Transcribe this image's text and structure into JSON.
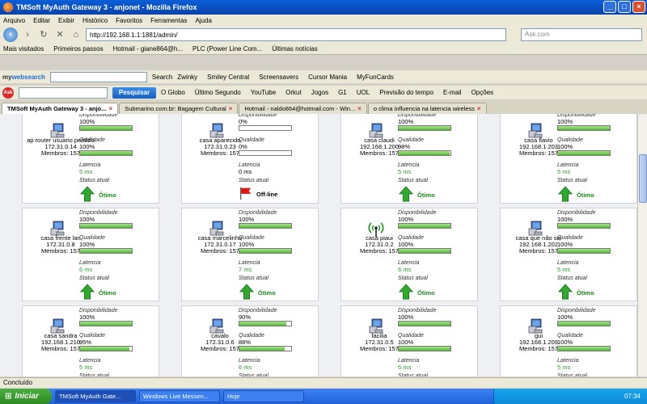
{
  "window": {
    "title": "TMSoft MyAuth Gateway 3 - anjonet - Mozilla Firefox"
  },
  "menu": [
    "Arquivo",
    "Editar",
    "Exibir",
    "Histórico",
    "Favoritos",
    "Ferramentas",
    "Ajuda"
  ],
  "nav": {
    "url": "http://192.168.1.1:1881/admin/",
    "search_placeholder": "Ask.com"
  },
  "bookmarks": [
    "Mais visitados",
    "Primeiros passos",
    "Hotmail - giane864@h...",
    "PLC (Power Line Com...",
    "Últimas notícias"
  ],
  "toolbar1": {
    "logo_a": "my",
    "logo_b": "websearch",
    "search_label": "Search",
    "items": [
      "Zwinky",
      "Smiley Central",
      "Screensavers",
      "Cursor Mania",
      "MyFunCards"
    ]
  },
  "toolbar2": {
    "search_button": "Pesquisar",
    "items": [
      "O Globo",
      "Último Segundo",
      "YouTube",
      "Orkut",
      "Jogos",
      "G1",
      "UOL",
      "Previsão do tempo",
      "E-mail",
      "Opções"
    ]
  },
  "tabs": [
    {
      "label": "TMSoft MyAuth Gateway 3 - anjo...",
      "active": true
    },
    {
      "label": "Submarino.com.br: Bagagem Cultural",
      "active": false
    },
    {
      "label": "Hotmail - naldo864@hotmail.com - Win...",
      "active": false
    },
    {
      "label": "o clima influencia na latencia wireless",
      "active": false
    }
  ],
  "labels": {
    "disp": "Disponibilidade",
    "qual": "Qualidade",
    "lat": "Latencia",
    "stat": "Status atual",
    "membros": "Membros:"
  },
  "devices": [
    {
      "name": "ap router usuario perdido",
      "ip": "172.31.0.14",
      "membros": "157",
      "disp": 100,
      "qual": 100,
      "lat": "5 ms",
      "status": "Ótimo",
      "icon": "pc"
    },
    {
      "name": "casa aparecido",
      "ip": "172.31.0.23",
      "membros": "157",
      "disp": 0,
      "qual": 0,
      "lat": "0 ms",
      "status": "Off-line",
      "icon": "pc"
    },
    {
      "name": "casa claudi",
      "ip": "192.168.1.200",
      "membros": "157",
      "disp": 100,
      "qual": 98,
      "lat": "5 ms",
      "status": "Ótimo",
      "icon": "pc"
    },
    {
      "name": "casa flavio",
      "ip": "192.168.1.203",
      "membros": "157",
      "disp": 100,
      "qual": 100,
      "lat": "5 ms",
      "status": "Ótimo",
      "icon": "pc"
    },
    {
      "name": "casa frente lan",
      "ip": "172.31.0.8",
      "membros": "157",
      "disp": 100,
      "qual": 100,
      "lat": "6 ms",
      "status": "Ótimo",
      "icon": "pc"
    },
    {
      "name": "casa marcelinho",
      "ip": "172.31.0.17",
      "membros": "157",
      "disp": 100,
      "qual": 100,
      "lat": "7 ms",
      "status": "Ótimo",
      "icon": "pc"
    },
    {
      "name": "casa piaui",
      "ip": "172.31.0.2",
      "membros": "157",
      "disp": 100,
      "qual": 100,
      "lat": "6 ms",
      "status": "Ótimo",
      "icon": "antenna"
    },
    {
      "name": "casa que não sei",
      "ip": "192.168.1.202",
      "membros": "157",
      "disp": 100,
      "qual": 100,
      "lat": "5 ms",
      "status": "Ótimo",
      "icon": "pc"
    },
    {
      "name": "casa sandra",
      "ip": "192.168.1.210",
      "membros": "157",
      "disp": 100,
      "qual": 95,
      "lat": "5 ms",
      "status": "",
      "icon": "pc"
    },
    {
      "name": "cavalo",
      "ip": "172.31.0.6",
      "membros": "157",
      "disp": 90,
      "qual": 88,
      "lat": "6 ms",
      "status": "",
      "icon": "pc"
    },
    {
      "name": "facilia",
      "ip": "172.31.0.5",
      "membros": "157",
      "disp": 100,
      "qual": 100,
      "lat": "5 ms",
      "status": "",
      "icon": "pc"
    },
    {
      "name": "gui",
      "ip": "192.168.1.209",
      "membros": "157",
      "disp": 100,
      "qual": 100,
      "lat": "5 ms",
      "status": "",
      "icon": "pc"
    }
  ],
  "status_bar": "Concluído",
  "taskbar": {
    "start": "Iniciar",
    "tasks": [
      "TMSoft MyAuth Gate...",
      "Windows Live Messen...",
      "Hoje"
    ],
    "clock": "07:34"
  }
}
